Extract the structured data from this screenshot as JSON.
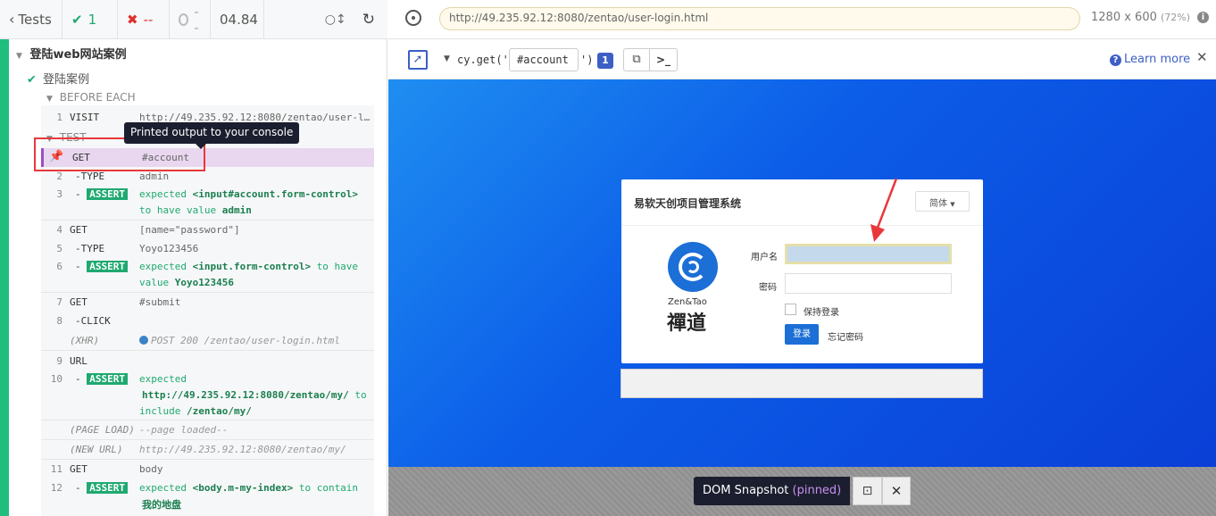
{
  "reporter": {
    "back_label": "Tests",
    "passed": "1",
    "failed": "--",
    "pending": "--",
    "duration": "04.84"
  },
  "suite": {
    "title": "登陆web网站案例",
    "test_title": "登陆案例",
    "before_each": "BEFORE EACH",
    "test_label": "TEST"
  },
  "commands": [
    {
      "num": "1",
      "name": "VISIT",
      "msg": "http://49.235.92.12:8080/zentao/user-l…"
    },
    {
      "num": "",
      "name": "GET",
      "msg": "#account"
    },
    {
      "num": "2",
      "name": "-TYPE",
      "msg": "admin"
    },
    {
      "num": "3",
      "name": "ASSERT",
      "msg_a": "expected",
      "msg_b": "<input#account.form-control>",
      "msg_c": "to have value",
      "msg_d": "admin"
    },
    {
      "num": "4",
      "name": "GET",
      "msg": "[name=\"password\"]"
    },
    {
      "num": "5",
      "name": "-TYPE",
      "msg": "Yoyo123456"
    },
    {
      "num": "6",
      "name": "ASSERT",
      "msg_a": "expected",
      "msg_b": "<input.form-control>",
      "msg_c": "to have",
      "msg_c2": "value",
      "msg_d": "Yoyo123456"
    },
    {
      "num": "7",
      "name": "GET",
      "msg": "#submit"
    },
    {
      "num": "8",
      "name": "-CLICK",
      "msg": ""
    },
    {
      "num": "",
      "name": "(XHR)",
      "msg": "POST 200 /zentao/user-login.html"
    },
    {
      "num": "9",
      "name": "URL",
      "msg": ""
    },
    {
      "num": "10",
      "name": "ASSERT",
      "msg_a": "expected",
      "msg_b": "http://49.235.92.12:8080/zentao/my/",
      "msg_c": "to",
      "msg_c2": "include",
      "msg_d": "/zentao/my/"
    },
    {
      "num": "",
      "name": "(PAGE LOAD)",
      "msg": "--page loaded--"
    },
    {
      "num": "",
      "name": "(NEW URL)",
      "msg": "http://49.235.92.12:8080/zentao/my/"
    },
    {
      "num": "11",
      "name": "GET",
      "msg": "body"
    },
    {
      "num": "12",
      "name": "ASSERT",
      "msg_a": "expected",
      "msg_b": "<body.m-my-index>",
      "msg_c": "to contain",
      "msg_d": "我的地盘"
    }
  ],
  "tooltip": "Printed output to your console",
  "browser": {
    "url": "http://49.235.92.12:8080/zentao/user-login.html",
    "viewport": "1280 x 600",
    "scale": "(72%)"
  },
  "selector": {
    "prefix": "cy.get('",
    "value": "#account",
    "suffix": "')",
    "count": "1",
    "learn_more": "Learn more"
  },
  "login": {
    "title": "易软天创项目管理系统",
    "lang": "简体",
    "logo_text": "Zen&Tao",
    "logo_chars": "禪道",
    "user_label": "用户名",
    "pass_label": "密码",
    "remember": "保持登录",
    "submit": "登录",
    "forgot": "忘记密码"
  },
  "snapshot": {
    "label": "DOM Snapshot",
    "pinned": "(pinned)"
  },
  "colors": {
    "pass": "#1fa971",
    "fail": "#e0302d",
    "accent": "#1fbe7f",
    "highlight": "#e8d7ee"
  }
}
